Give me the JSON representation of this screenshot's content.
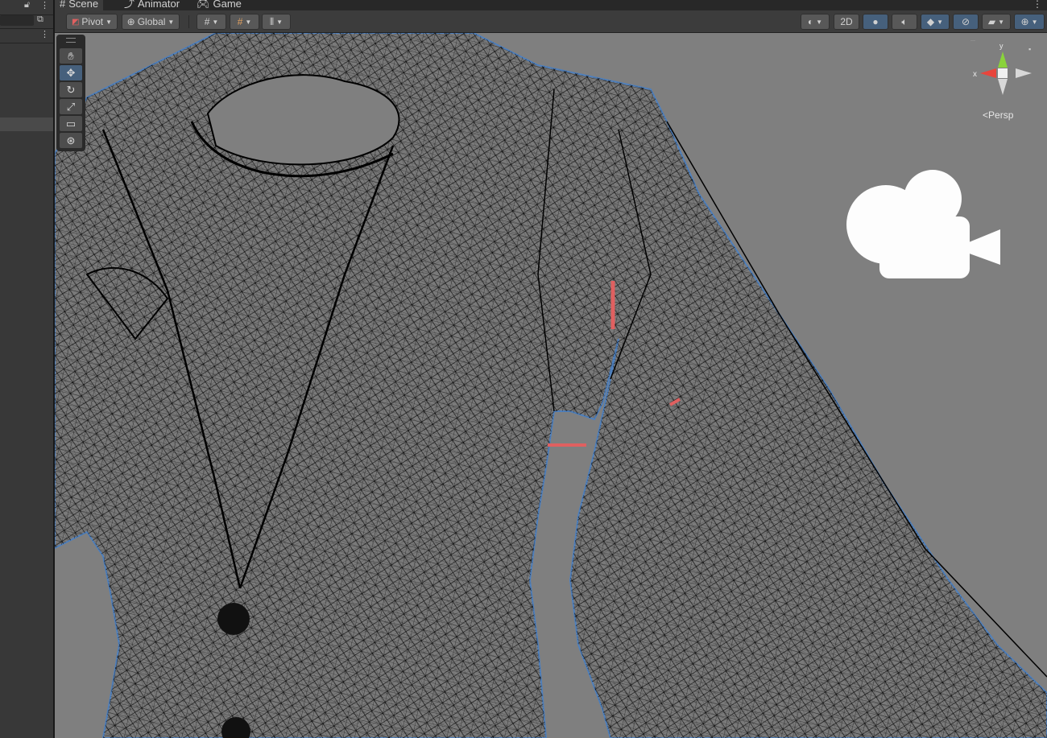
{
  "tabs": [
    {
      "label": "Scene",
      "icon": "grid-icon"
    },
    {
      "label": "Animator",
      "icon": "animator-icon"
    },
    {
      "label": "Game",
      "icon": "gamepad-icon"
    }
  ],
  "toolbar": {
    "pivot_label": "Pivot",
    "global_label": "Global",
    "mode_2d_label": "2D"
  },
  "scene": {
    "camera_mode_label": "Persp",
    "axis_x_label": "x",
    "axis_y_label": "y"
  },
  "colors": {
    "accent": "#46607c",
    "selection_outline": "#4f80bd",
    "axis_x": "#e8453c",
    "axis_y": "#8ad33b",
    "bone_marker": "#e06060"
  }
}
